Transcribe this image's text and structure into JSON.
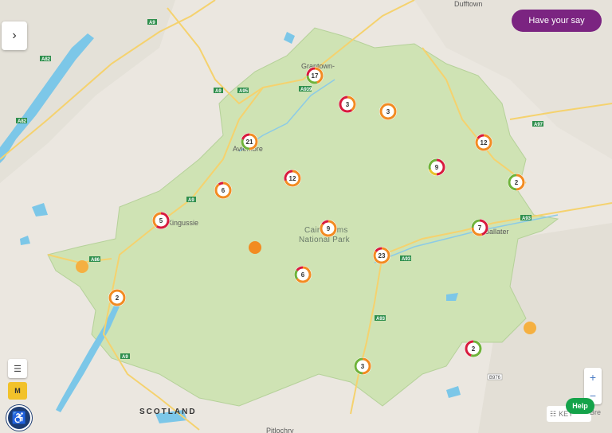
{
  "controls": {
    "have_your_say": "Have your say",
    "sidebar_toggle": "›",
    "list_icon": "☰",
    "m_button": "M",
    "accessibility_icon": "♿",
    "zoom_in": "+",
    "zoom_out": "−",
    "key_label": "KEY",
    "help_label": "Help",
    "br_label": "Bre"
  },
  "labels": {
    "park_line1": "Cairngorms",
    "park_line2": "National Park",
    "country": "SCOTLAND"
  },
  "places": [
    {
      "name": "Dufftown"
    },
    {
      "name": "Grantown-"
    },
    {
      "name": "Aviemore"
    },
    {
      "name": "Kingussie"
    },
    {
      "name": "Ballater"
    },
    {
      "name": "Pitlochry"
    }
  ],
  "roads": [
    "A82",
    "A9",
    "A95",
    "A939",
    "A97",
    "A93",
    "A86",
    "B976"
  ],
  "colors": {
    "park_fill": "#cfe3b4",
    "water": "#7cc7e8",
    "brand_purple": "#7b2481",
    "ring_orange": "#f28b22",
    "ring_red": "#d81b3e",
    "ring_green": "#6fb33a",
    "ring_yellow": "#e7c42b",
    "dot_orange": "#f28b22",
    "dot_yellow": "#f5b041"
  },
  "clusters": [
    {
      "count": "17"
    },
    {
      "count": "3"
    },
    {
      "count": "3"
    },
    {
      "count": "21"
    },
    {
      "count": "12"
    },
    {
      "count": "9"
    },
    {
      "count": "12"
    },
    {
      "count": "2"
    },
    {
      "count": "6"
    },
    {
      "count": "5"
    },
    {
      "count": "9"
    },
    {
      "count": "7"
    },
    {
      "count": "23"
    },
    {
      "count": "6"
    },
    {
      "count": "2"
    },
    {
      "count": "2"
    },
    {
      "count": "3"
    }
  ],
  "pins": [
    {
      "color": "#f28b22"
    },
    {
      "color": "#f5b041"
    },
    {
      "color": "#f5b041"
    }
  ]
}
